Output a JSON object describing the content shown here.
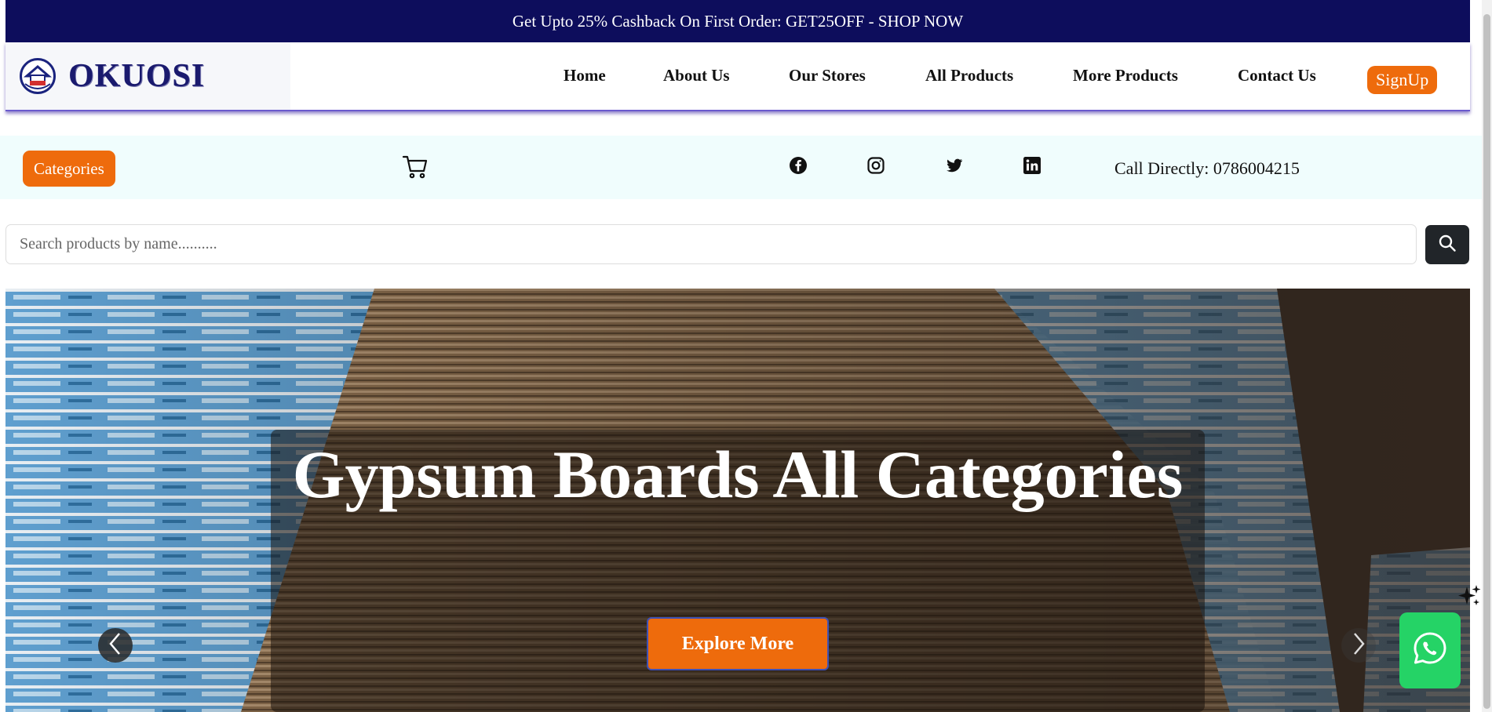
{
  "promo": {
    "text": "Get Upto 25% Cashback On First Order: GET25OFF - SHOP NOW"
  },
  "brand": {
    "name": "OKUOSI",
    "logo": "house-seal-logo",
    "color": "#1a1a6e"
  },
  "nav": {
    "items": [
      {
        "label": "Home"
      },
      {
        "label": "About Us"
      },
      {
        "label": "Our Stores"
      },
      {
        "label": "All Products"
      },
      {
        "label": "More Products"
      },
      {
        "label": "Contact Us"
      }
    ],
    "signup_label": "SignUp"
  },
  "utility": {
    "categories_label": "Categories",
    "cart_icon": "cart-icon",
    "social": [
      "facebook-icon",
      "instagram-icon",
      "twitter-icon",
      "linkedin-icon"
    ],
    "call_text": "Call Directly: 0786004215"
  },
  "search": {
    "placeholder": "Search products by name..........",
    "value": "",
    "button_icon": "search-icon"
  },
  "hero": {
    "title": "Gypsum Boards All Categories",
    "cta_label": "Explore More",
    "prev_icon": "chevron-left-icon",
    "next_icon": "chevron-right-icon"
  },
  "floating": {
    "assistant_icon": "sparkle-icon",
    "chat_icon": "whatsapp-icon"
  },
  "colors": {
    "accent": "#ee6b0c",
    "promo_bg": "#0d0d5c",
    "utility_bg": "#f0fdfd",
    "whatsapp": "#25d366"
  }
}
